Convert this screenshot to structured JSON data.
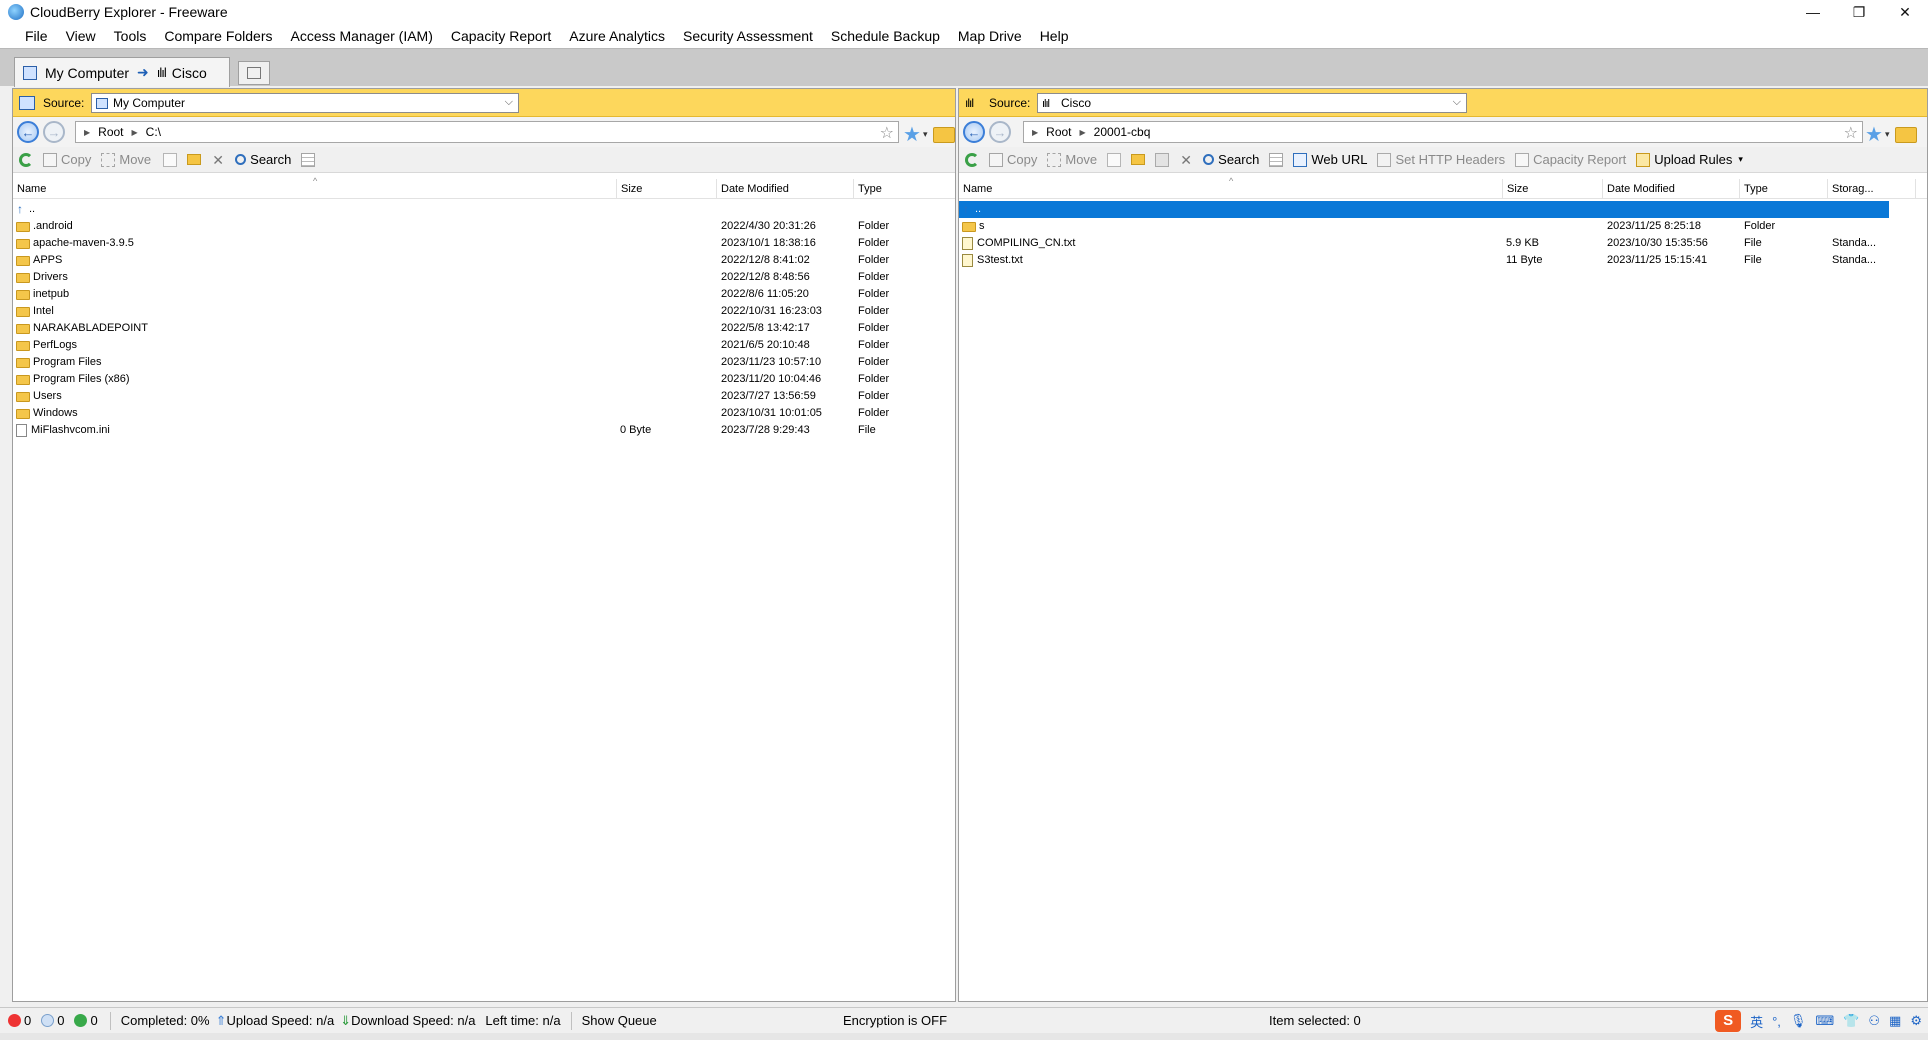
{
  "window": {
    "title": "CloudBerry Explorer - Freeware",
    "controls": [
      "—",
      "❐",
      "✕"
    ]
  },
  "menu": [
    "File",
    "View",
    "Tools",
    "Compare Folders",
    "Access Manager (IAM)",
    "Capacity Report",
    "Azure Analytics",
    "Security Assessment",
    "Schedule Backup",
    "Map Drive",
    "Help"
  ],
  "session_tab": {
    "left": "My Computer",
    "arrow": "➜",
    "right": "Cisco"
  },
  "left_pane": {
    "source_label": "Source:",
    "source_value": "My Computer",
    "path": [
      "Root",
      "C:\\"
    ],
    "toolbar": {
      "copy": "Copy",
      "move": "Move",
      "search": "Search"
    },
    "columns": [
      "Name",
      "Size",
      "Date Modified",
      "Type"
    ],
    "parent_row": "..",
    "rows": [
      {
        "name": ".android",
        "size": "",
        "date": "2022/4/30 20:31:26",
        "type": "Folder",
        "kind": "folder"
      },
      {
        "name": "apache-maven-3.9.5",
        "size": "",
        "date": "2023/10/1 18:38:16",
        "type": "Folder",
        "kind": "folder"
      },
      {
        "name": "APPS",
        "size": "",
        "date": "2022/12/8 8:41:02",
        "type": "Folder",
        "kind": "folder"
      },
      {
        "name": "Drivers",
        "size": "",
        "date": "2022/12/8 8:48:56",
        "type": "Folder",
        "kind": "folder"
      },
      {
        "name": "inetpub",
        "size": "",
        "date": "2022/8/6 11:05:20",
        "type": "Folder",
        "kind": "folder"
      },
      {
        "name": "Intel",
        "size": "",
        "date": "2022/10/31 16:23:03",
        "type": "Folder",
        "kind": "folder"
      },
      {
        "name": "NARAKABLADEPOINT",
        "size": "",
        "date": "2022/5/8 13:42:17",
        "type": "Folder",
        "kind": "folder"
      },
      {
        "name": "PerfLogs",
        "size": "",
        "date": "2021/6/5 20:10:48",
        "type": "Folder",
        "kind": "folder"
      },
      {
        "name": "Program Files",
        "size": "",
        "date": "2023/11/23 10:57:10",
        "type": "Folder",
        "kind": "folder"
      },
      {
        "name": "Program Files (x86)",
        "size": "",
        "date": "2023/11/20 10:04:46",
        "type": "Folder",
        "kind": "folder"
      },
      {
        "name": "Users",
        "size": "",
        "date": "2023/7/27 13:56:59",
        "type": "Folder",
        "kind": "folder"
      },
      {
        "name": "Windows",
        "size": "",
        "date": "2023/10/31 10:01:05",
        "type": "Folder",
        "kind": "folder"
      },
      {
        "name": "MiFlashvcom.ini",
        "size": "0 Byte",
        "date": "2023/7/28 9:29:43",
        "type": "File",
        "kind": "file"
      }
    ]
  },
  "right_pane": {
    "source_label": "Source:",
    "source_value": "Cisco",
    "path": [
      "Root",
      "20001-cbq"
    ],
    "toolbar": {
      "copy": "Copy",
      "move": "Move",
      "search": "Search",
      "web_url": "Web URL",
      "set_headers": "Set HTTP Headers",
      "capacity": "Capacity Report",
      "upload_rules": "Upload Rules"
    },
    "columns": [
      "Name",
      "Size",
      "Date Modified",
      "Type",
      "Storag..."
    ],
    "parent_row": "..",
    "rows": [
      {
        "name": "s",
        "size": "",
        "date": "2023/11/25 8:25:18",
        "type": "Folder",
        "storage": "",
        "kind": "folder"
      },
      {
        "name": "COMPILING_CN.txt",
        "size": "5.9 KB",
        "date": "2023/10/30 15:35:56",
        "type": "File",
        "storage": "Standa...",
        "kind": "txt"
      },
      {
        "name": "S3test.txt",
        "size": "11 Byte",
        "date": "2023/11/25 15:15:41",
        "type": "File",
        "storage": "Standa...",
        "kind": "txt"
      }
    ]
  },
  "status": {
    "errors": "0",
    "queued": "0",
    "running": "0",
    "completed": "Completed: 0%",
    "upload": "Upload Speed: n/a",
    "download": "Download Speed: n/a",
    "left_time": "Left time: n/a",
    "show_queue": "Show Queue",
    "encryption": "Encryption is OFF",
    "selected": "Item selected: 0"
  },
  "tray": {
    "ime": "S",
    "lang": "英"
  }
}
